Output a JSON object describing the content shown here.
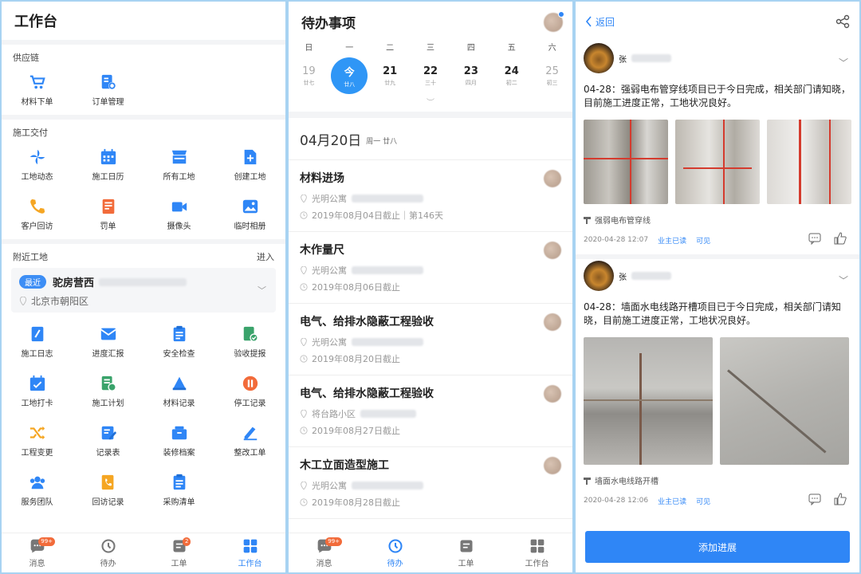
{
  "workbench": {
    "title": "工作台",
    "supply_chain": {
      "title": "供应链",
      "items": [
        {
          "label": "材料下单",
          "icon": "cart-icon"
        },
        {
          "label": "订单管理",
          "icon": "order-gear-icon"
        }
      ]
    },
    "construction": {
      "title": "施工交付",
      "items": [
        {
          "label": "工地动态",
          "icon": "pinwheel-icon"
        },
        {
          "label": "施工日历",
          "icon": "calendar-icon"
        },
        {
          "label": "所有工地",
          "icon": "store-icon"
        },
        {
          "label": "创建工地",
          "icon": "doc-plus-icon"
        },
        {
          "label": "客户回访",
          "icon": "phone-icon"
        },
        {
          "label": "罚单",
          "icon": "ticket-icon"
        },
        {
          "label": "摄像头",
          "icon": "video-icon"
        },
        {
          "label": "临时相册",
          "icon": "photo-icon"
        }
      ]
    },
    "nearby": {
      "title": "附近工地",
      "enter": "进入",
      "tag": "最近",
      "site_name": "驼房营西",
      "address": "北京市朝阳区",
      "items": [
        {
          "label": "施工日志",
          "icon": "log-icon"
        },
        {
          "label": "进度汇报",
          "icon": "mail-icon"
        },
        {
          "label": "安全检查",
          "icon": "clipboard-icon"
        },
        {
          "label": "验收提报",
          "icon": "checked-doc-icon"
        },
        {
          "label": "工地打卡",
          "icon": "calendar-check-icon"
        },
        {
          "label": "施工计划",
          "icon": "plan-icon"
        },
        {
          "label": "材料记录",
          "icon": "stack-icon"
        },
        {
          "label": "停工记录",
          "icon": "pause-icon"
        },
        {
          "label": "工程变更",
          "icon": "shuffle-icon"
        },
        {
          "label": "记录表",
          "icon": "edit-doc-icon"
        },
        {
          "label": "装修档案",
          "icon": "archive-icon"
        },
        {
          "label": "整改工单",
          "icon": "pen-icon"
        },
        {
          "label": "服务团队",
          "icon": "team-icon"
        },
        {
          "label": "回访记录",
          "icon": "phone-record-icon"
        },
        {
          "label": "采购清单",
          "icon": "list-icon"
        }
      ]
    },
    "tabs": [
      {
        "label": "消息",
        "badge": "99+"
      },
      {
        "label": "待办",
        "badge": ""
      },
      {
        "label": "工单",
        "badge": "2"
      },
      {
        "label": "工作台",
        "badge": ""
      }
    ]
  },
  "todo": {
    "title": "待办事项",
    "weekdays": [
      "日",
      "一",
      "二",
      "三",
      "四",
      "五",
      "六"
    ],
    "days": [
      {
        "num": "19",
        "lunar": "廿七"
      },
      {
        "num": "今",
        "lunar": "廿八"
      },
      {
        "num": "21",
        "lunar": "廿九"
      },
      {
        "num": "22",
        "lunar": "三十"
      },
      {
        "num": "23",
        "lunar": "四月"
      },
      {
        "num": "24",
        "lunar": "初二"
      },
      {
        "num": "25",
        "lunar": "初三"
      }
    ],
    "date": "04月20日",
    "date_sub": "周一 廿八",
    "items": [
      {
        "title": "材料进场",
        "location": "光明公寓",
        "deadline": "2019年08月04日截止｜第146天"
      },
      {
        "title": "木作量尺",
        "location": "光明公寓",
        "deadline": "2019年08月06日截止"
      },
      {
        "title": "电气、给排水隐蔽工程验收",
        "location": "光明公寓",
        "deadline": "2019年08月20日截止"
      },
      {
        "title": "电气、给排水隐蔽工程验收",
        "location": "将台路小区",
        "deadline": "2019年08月27日截止"
      },
      {
        "title": "木工立面造型施工",
        "location": "光明公寓",
        "deadline": "2019年08月28日截止"
      }
    ],
    "tabs": [
      {
        "label": "消息",
        "badge": "99+"
      },
      {
        "label": "待办",
        "badge": ""
      },
      {
        "label": "工单",
        "badge": ""
      },
      {
        "label": "工作台",
        "badge": ""
      }
    ]
  },
  "detail": {
    "back": "返回",
    "posts": [
      {
        "user": "张",
        "text": "04-28：强弱电布管穿线项目已于今日完成，相关部门请知晓，目前施工进度正常，工地状况良好。",
        "caption": "强弱电布管穿线",
        "time": "2020-04-28 12:07",
        "read": "业主已读",
        "visible": "可见"
      },
      {
        "user": "张",
        "text": "04-28：墙面水电线路开槽项目已于今日完成，相关部门请知晓，目前施工进度正常，工地状况良好。",
        "caption": "墙面水电线路开槽",
        "time": "2020-04-28 12:06",
        "read": "业主已读",
        "visible": "可见"
      }
    ],
    "add_button": "添加进展"
  },
  "colors": {
    "accent": "#2f86f6",
    "background": "#a8d3f2"
  }
}
